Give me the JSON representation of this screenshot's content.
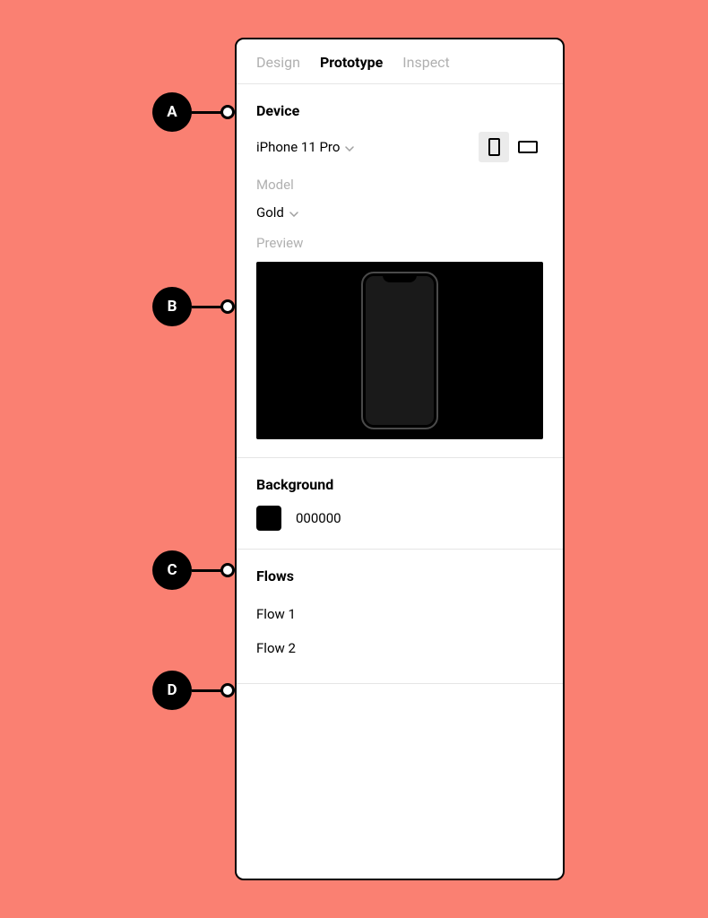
{
  "tabs": {
    "design": "Design",
    "prototype": "Prototype",
    "inspect": "Inspect"
  },
  "device": {
    "heading": "Device",
    "selected": "iPhone 11 Pro",
    "model_label": "Model",
    "model_selected": "Gold",
    "preview_label": "Preview"
  },
  "background": {
    "heading": "Background",
    "value": "000000"
  },
  "flows": {
    "heading": "Flows",
    "items": [
      "Flow 1",
      "Flow 2"
    ]
  },
  "callouts": {
    "a": "A",
    "b": "B",
    "c": "C",
    "d": "D"
  }
}
